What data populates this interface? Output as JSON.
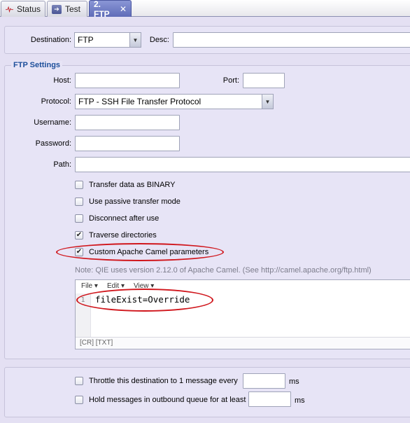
{
  "tabs": [
    {
      "label": "Status",
      "icon": "pulse-icon"
    },
    {
      "label": "Test",
      "icon": "test-arrow-icon"
    },
    {
      "label": "2. FTP",
      "icon": "close-icon",
      "close_glyph": "✕"
    }
  ],
  "destination": {
    "label": "Destination:",
    "value": "FTP",
    "desc_label": "Desc:",
    "desc_value": ""
  },
  "ftp": {
    "section_title": "FTP Settings",
    "host_label": "Host:",
    "host_value": "",
    "port_label": "Port:",
    "port_value": "",
    "protocol_label": "Protocol:",
    "protocol_value": "FTP - SSH File Transfer Protocol",
    "username_label": "Username:",
    "username_value": "",
    "password_label": "Password:",
    "password_value": "",
    "path_label": "Path:",
    "path_value": ""
  },
  "options": [
    {
      "label": "Transfer data as BINARY",
      "checked": false
    },
    {
      "label": "Use passive transfer mode",
      "checked": false
    },
    {
      "label": "Disconnect after use",
      "checked": false
    },
    {
      "label": "Traverse directories",
      "checked": true
    },
    {
      "label": "Custom Apache Camel parameters",
      "checked": true
    }
  ],
  "note": "Note: QIE uses version 2.12.0 of Apache Camel. (See http://camel.apache.org/ftp.html)",
  "editor": {
    "menu": [
      "File",
      "Edit",
      "View"
    ],
    "line_number": "1",
    "code": "fileExist=Override",
    "status": "[CR] [TXT]"
  },
  "throttle": {
    "label": "Throttle this destination to 1 message every",
    "value": "",
    "unit": "ms",
    "checked": false
  },
  "hold": {
    "label": "Hold messages in outbound queue for at least",
    "value": "",
    "unit": "ms",
    "checked": false
  },
  "colors": {
    "active_tab": "#6a77c4",
    "section_title": "#1c4e9a",
    "annotation": "#d0161c",
    "background": "#e4e0f3"
  }
}
